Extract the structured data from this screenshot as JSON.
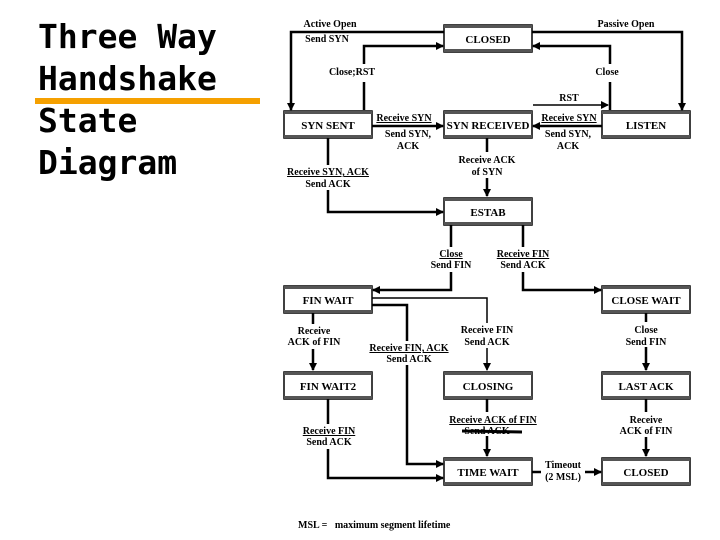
{
  "title_lines": [
    "Three Way",
    "Handshake",
    "State",
    "Diagram"
  ],
  "accent_color": "#f5a000",
  "states": {
    "closed_top": "CLOSED",
    "syn_sent": "SYN SENT",
    "syn_received": "SYN RECEIVED",
    "listen": "LISTEN",
    "estab": "ESTAB",
    "fin_wait": "FIN WAIT",
    "close_wait": "CLOSE WAIT",
    "fin_wait2": "FIN WAIT2",
    "closing": "CLOSING",
    "last_ack": "LAST ACK",
    "time_wait": "TIME WAIT",
    "closed_bottom": "CLOSED"
  },
  "labels": {
    "active_open": "Active Open",
    "send_syn": "Send SYN",
    "passive_open": "Passive Open",
    "close_rst": "Close;RST",
    "close": "Close",
    "rst": "RST",
    "recv_syn_left": [
      "Receive SYN",
      "Send SYN,",
      "ACK"
    ],
    "recv_syn_right": [
      "Receive SYN",
      "Send SYN,",
      "ACK"
    ],
    "recv_ack_syn": [
      "Receive ACK",
      "of SYN"
    ],
    "recv_synack": [
      "Receive SYN, ACK",
      "Send ACK"
    ],
    "close_send_fin": [
      "Close",
      "Send FIN"
    ],
    "recv_fin_send_ack": [
      "Receive FIN",
      "Send ACK"
    ],
    "recv_ack_fin_1": [
      "Receive",
      "ACK of FIN"
    ],
    "recv_fin_ack": [
      "Receive FIN, ACK",
      "Send ACK"
    ],
    "recv_fin_closing": [
      "Receive FIN",
      "Send ACK"
    ],
    "close_wait_close": [
      "Close",
      "Send FIN"
    ],
    "finwait2_recv_fin": [
      "Receive FIN",
      "Send ACK"
    ],
    "closing_recv_ack": [
      "Receive ACK of FIN",
      "Send ACK"
    ],
    "lastack_recv": [
      "Receive",
      "ACK of FIN"
    ],
    "timeout": [
      "Timeout",
      "(2 MSL)"
    ]
  },
  "footnote": "MSL =   maximum segment lifetime"
}
